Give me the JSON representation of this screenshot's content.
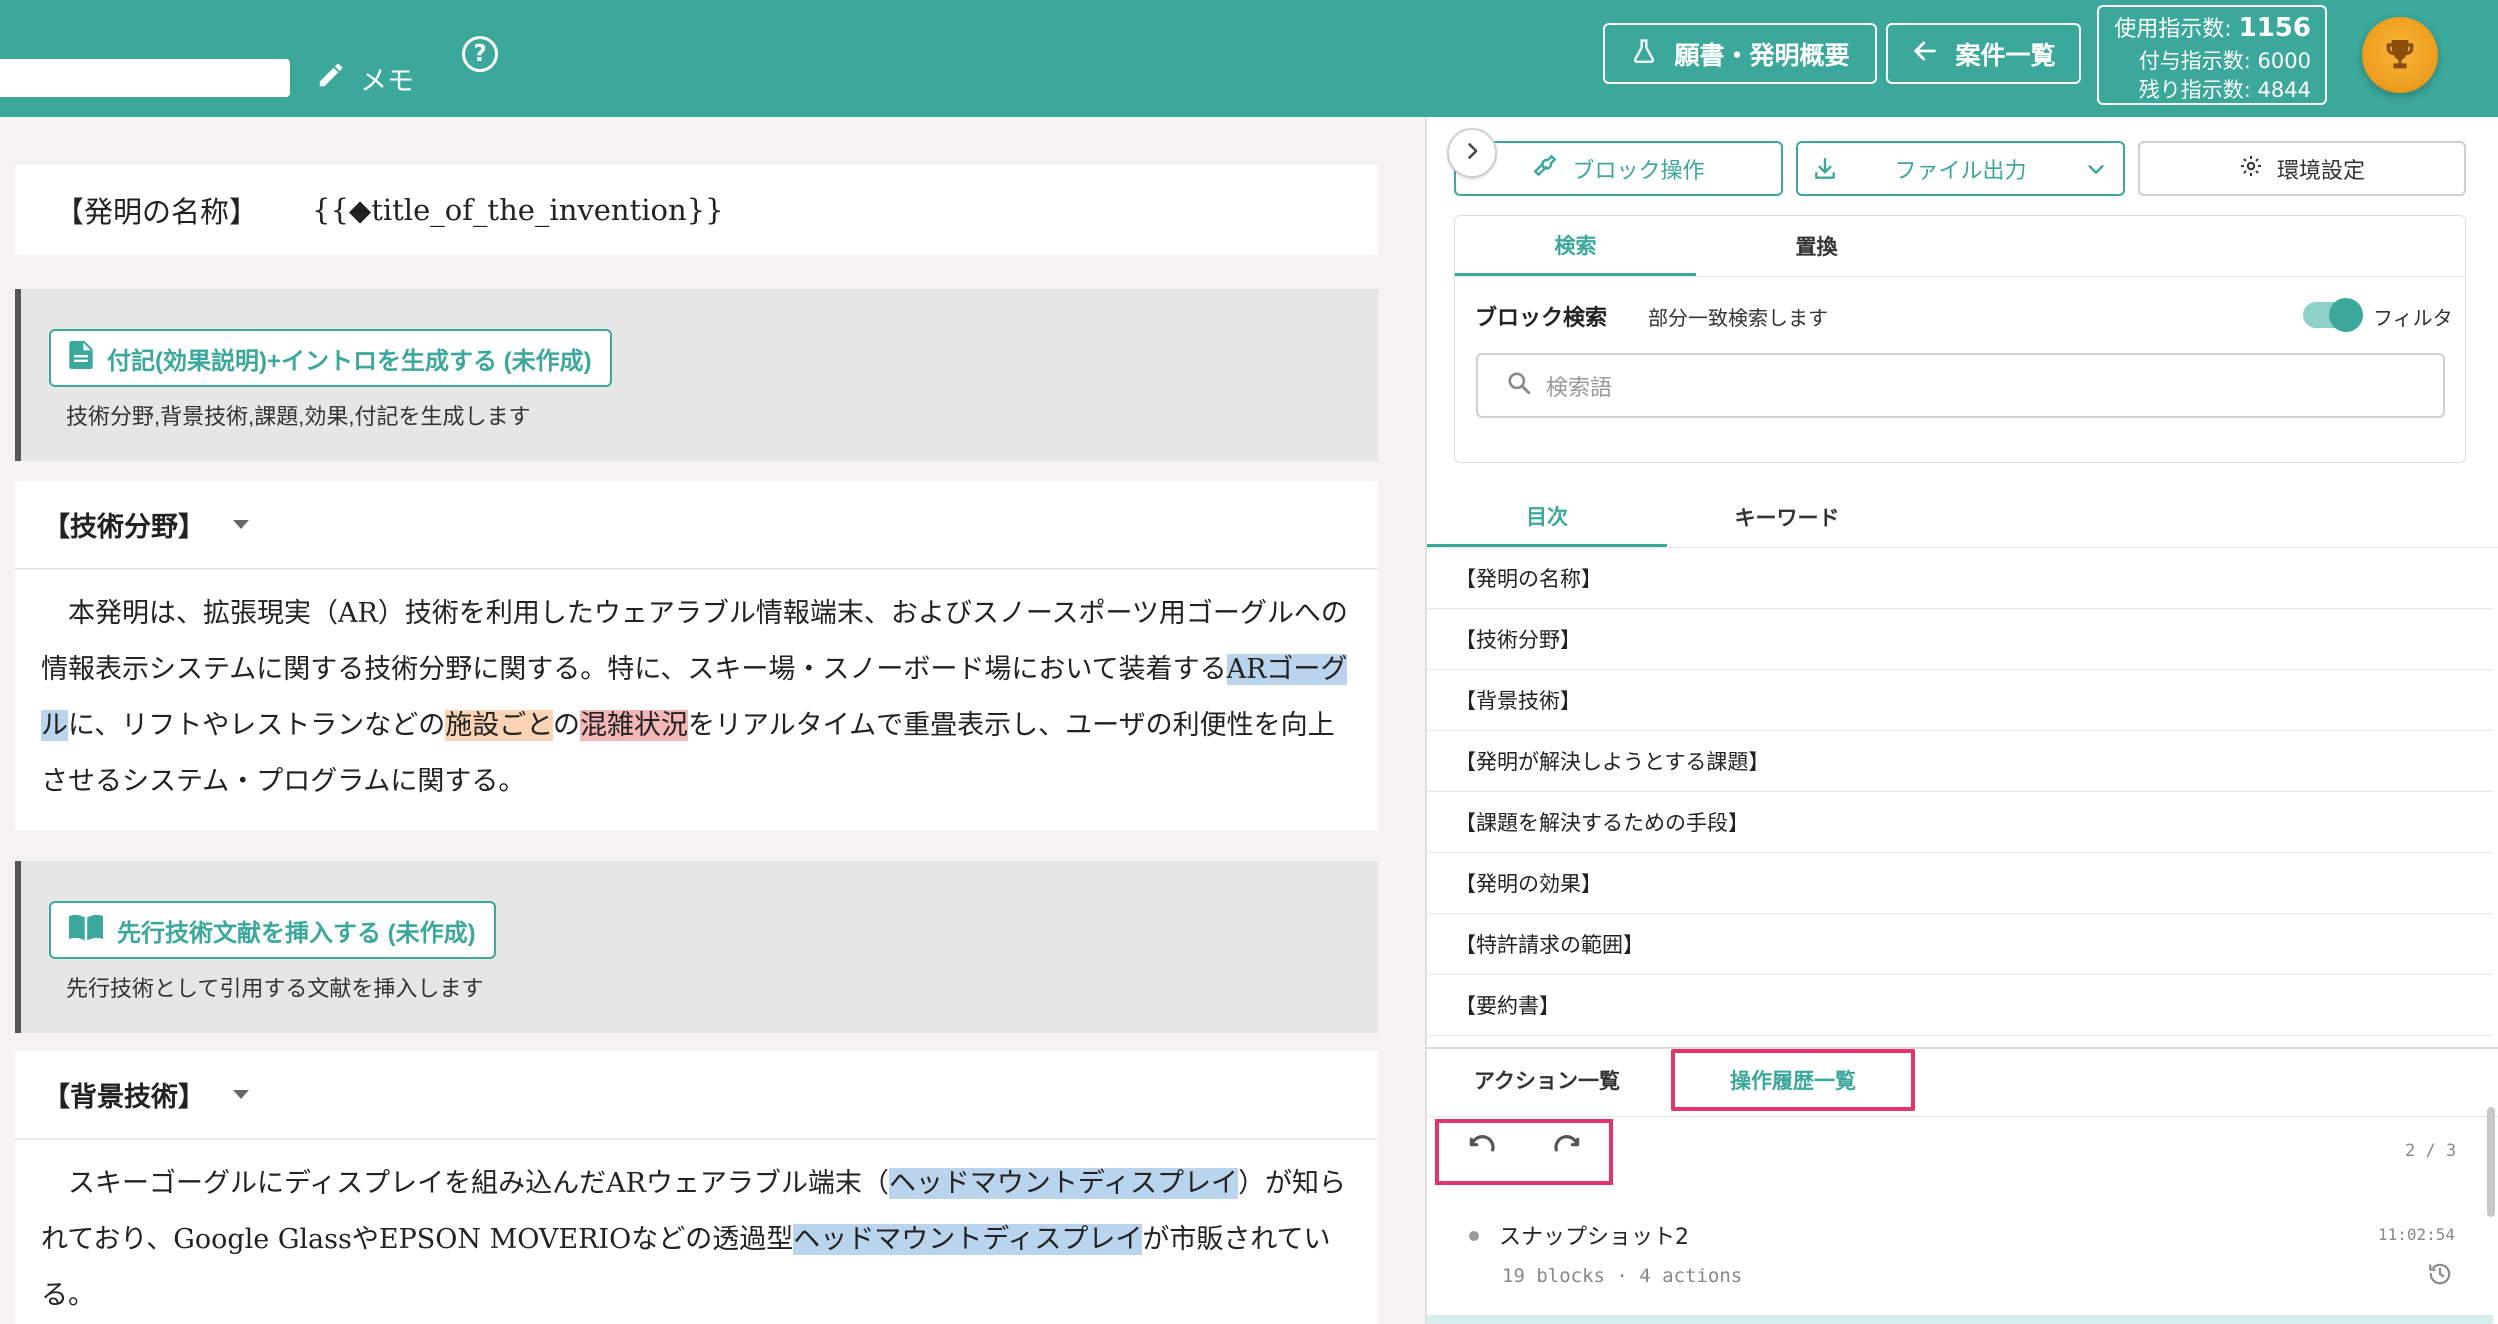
{
  "header": {
    "memo_label": "メモ",
    "help_glyph": "?",
    "overview_button": "願書・発明概要",
    "cases_button": "案件一覧",
    "usage_label": "使用指示数:",
    "usage_value": "1156",
    "granted_line": "付与指示数: 6000",
    "remaining_line": "残り指示数: 4844",
    "trophy_icon": "trophy-icon",
    "accent_color": "#3ba89b"
  },
  "document": {
    "name_block": {
      "label": "【発明の名称】",
      "value": "{{◆title_of_the_invention}}"
    },
    "gen_intro": {
      "button": "付記(効果説明)+イントロを生成する (未作成)",
      "description": "技術分野,背景技術,課題,効果,付記を生成します"
    },
    "tech_field": {
      "heading": "【技術分野】",
      "p1": "　本発明は、拡張現実（AR）技術を利用したウェアラブル情報端末、およびスノースポーツ用ゴーグルへの情報表示システムに関する技術分野に関する。特に、スキー場・スノーボード場において装着する",
      "hl1": "ARゴーグル",
      "p2": "に、リフトやレストランなどの",
      "hl2": "施設ごと",
      "p3": "の",
      "hl3": "混雑状況",
      "p4": "をリアルタイムで重畳表示し、ユーザの利便性を向上させるシステム・プログラムに関する。"
    },
    "prior_art": {
      "button": "先行技術文献を挿入する (未作成)",
      "description": "先行技術として引用する文献を挿入します"
    },
    "background": {
      "heading": "【背景技術】",
      "p1": "　スキーゴーグルにディスプレイを組み込んだARウェアラブル端末（",
      "hl1": "ヘッドマウントディスプレイ",
      "p2": "）が知られており、Google GlassやEPSON MOVERIOなどの透過型",
      "hl2": "ヘッドマウントディスプレイ",
      "p3": "が市販されている。"
    }
  },
  "panel": {
    "block_ops": "ブロック操作",
    "file_output": "ファイル出力",
    "settings": "環境設定",
    "search_tabs": [
      "検索",
      "置換"
    ],
    "block_search_title": "ブロック検索",
    "block_search_desc": "部分一致検索します",
    "filter_label": "フィルタ",
    "filter_on": true,
    "search_placeholder": "検索語",
    "toc_tabs": [
      "目次",
      "キーワード"
    ],
    "toc_items": [
      "【発明の名称】",
      "【技術分野】",
      "【背景技術】",
      "【発明が解決しようとする課題】",
      "【課題を解決するための手段】",
      "【発明の効果】",
      "【特許請求の範囲】",
      "【要約書】"
    ],
    "history_tabs": [
      "アクション一覧",
      "操作履歴一覧"
    ],
    "page_count": "2 / 3",
    "snapshot": {
      "name": "スナップショット2",
      "time": "11:02:54",
      "meta": "19 blocks · 4 actions"
    }
  }
}
